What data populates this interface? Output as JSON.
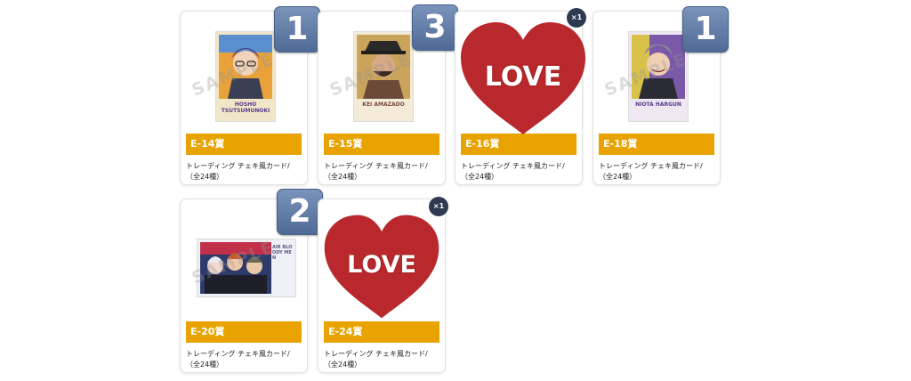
{
  "colors": {
    "prize_bar": "#e8a300",
    "count_badge": "#5f7aa3",
    "x_badge": "#2e3a4f",
    "heart": "#b9282d"
  },
  "watermark_text": "SAMPLE",
  "cards": [
    {
      "prize": "E-14賞",
      "desc": "トレーディング チェキ風カード/（全24種）",
      "count": "1",
      "card_text": "HOSHO TSUTSUMUNOKI"
    },
    {
      "prize": "E-15賞",
      "desc": "トレーディング チェキ風カード/（全24種）",
      "count": "3",
      "card_text": "KEI AMAZADO"
    },
    {
      "prize": "E-16賞",
      "desc": "トレーディング チェキ風カード/（全24種）",
      "x_count": "×1",
      "heart_label": "LOVE"
    },
    {
      "prize": "E-18賞",
      "desc": "トレーディング チェキ風カード/（全24種）",
      "count": "1",
      "card_text": "NIOTA HARGUN"
    },
    {
      "prize": "E-20賞",
      "desc": "トレーディング チェキ風カード/（全24種）",
      "count": "2",
      "card_text": "AIR BLOODY MEN"
    },
    {
      "prize": "E-24賞",
      "desc": "トレーディング チェキ風カード/（全24種）",
      "x_count": "×1",
      "heart_label": "LOVE"
    }
  ]
}
